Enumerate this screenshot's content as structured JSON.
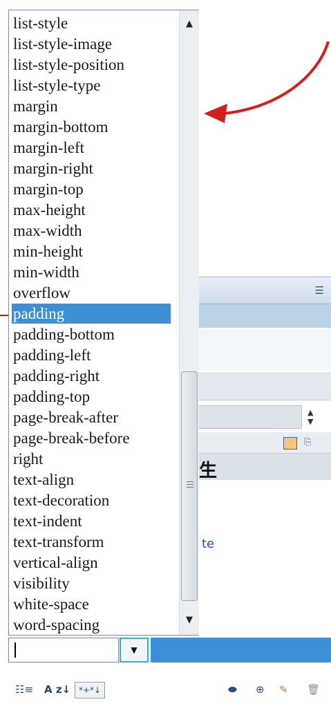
{
  "property_list": {
    "items": [
      "list-style",
      "list-style-image",
      "list-style-position",
      "list-style-type",
      "margin",
      "margin-bottom",
      "margin-left",
      "margin-right",
      "margin-top",
      "max-height",
      "max-width",
      "min-height",
      "min-width",
      "overflow",
      "padding",
      "padding-bottom",
      "padding-left",
      "padding-right",
      "padding-top",
      "page-break-after",
      "page-break-before",
      "right",
      "text-align",
      "text-decoration",
      "text-indent",
      "text-transform",
      "vertical-align",
      "visibility",
      "white-space",
      "word-spacing"
    ],
    "selected_item": "padding"
  },
  "combo_input": {
    "value": ""
  },
  "background_panel": {
    "cjk_text": "生",
    "link_text": "te"
  },
  "icons": {
    "scroll_up": "▲",
    "scroll_down": "▼",
    "combo_arrow": "▼",
    "panel_menu": "☰",
    "category_view": "☷≡",
    "alpha_sort": "A z↓",
    "set_properties": "*+*↓",
    "attach": "⬬",
    "new": "⊕",
    "edit": "✎",
    "delete": "🗑"
  },
  "colors": {
    "selection_bg": "#3d8fd6",
    "selection_fg": "#ffffff",
    "arrow_red": "#d41f1f",
    "combo_button_border": "#2bb7c8"
  }
}
